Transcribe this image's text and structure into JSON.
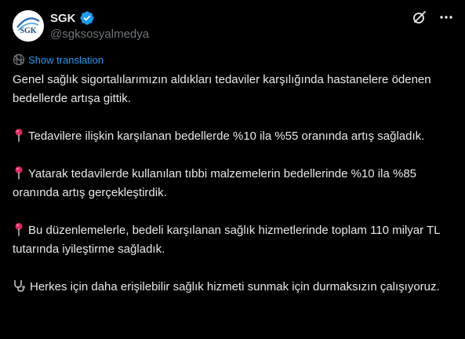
{
  "post": {
    "author": {
      "display_name": "SGK",
      "handle": "@sgksosyalmedya",
      "verified": true,
      "avatar_text": "SGK"
    },
    "header_icons": [
      "grok-icon",
      "more-icon"
    ],
    "translate_label": "Show translation",
    "paragraphs": [
      {
        "icon": null,
        "text": "Genel sağlık sigortalılarımızın aldıkları tedaviler karşılığında hastanelere ödenen bedellerde artışa gittik."
      },
      {
        "icon": "pin-icon",
        "text": "Tedavilere ilişkin karşılanan bedellerde %10 ila %55 oranında artış sağladık."
      },
      {
        "icon": "pin-icon",
        "text": "Yatarak tedavilerde kullanılan tıbbi malzemelerin bedellerinde %10 ila %85 oranında artış gerçekleştirdik."
      },
      {
        "icon": "pin-icon",
        "text": "Bu düzenlemelerle, bedeli karşılanan sağlık hizmetlerinde toplam 110 milyar TL tutarında iyileştirme sağladık."
      },
      {
        "icon": "stethoscope-icon",
        "text": "Herkes için daha erişilebilir sağlık hizmeti sunmak için durmaksızın çalışıyoruz."
      }
    ]
  },
  "colors": {
    "background": "#000000",
    "text": "#e7e9ea",
    "secondary_text": "#71767b",
    "link": "#1d9bf0",
    "verified": "#1d9bf0",
    "pin": "#e0245e"
  }
}
